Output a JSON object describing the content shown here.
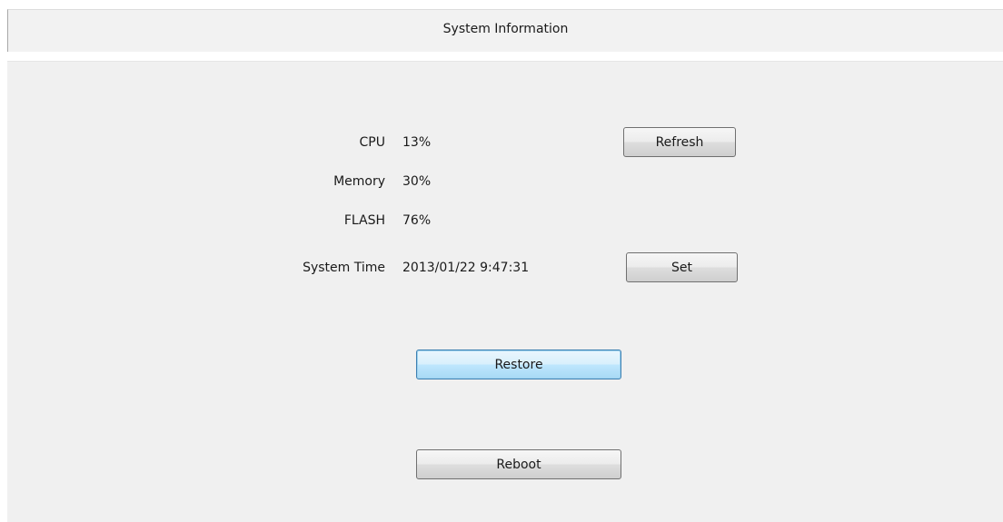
{
  "header": {
    "title": "System Information"
  },
  "info": {
    "cpu_label": "CPU",
    "cpu_value": "13%",
    "memory_label": "Memory",
    "memory_value": "30%",
    "flash_label": "FLASH",
    "flash_value": "76%",
    "time_label": "System Time",
    "time_value": "2013/01/22 9:47:31"
  },
  "buttons": {
    "refresh": "Refresh",
    "set": "Set",
    "restore": "Restore",
    "reboot": "Reboot"
  },
  "colors": {
    "panel_bg": "#f0f0f0",
    "focused_button": "#bee6fd"
  }
}
